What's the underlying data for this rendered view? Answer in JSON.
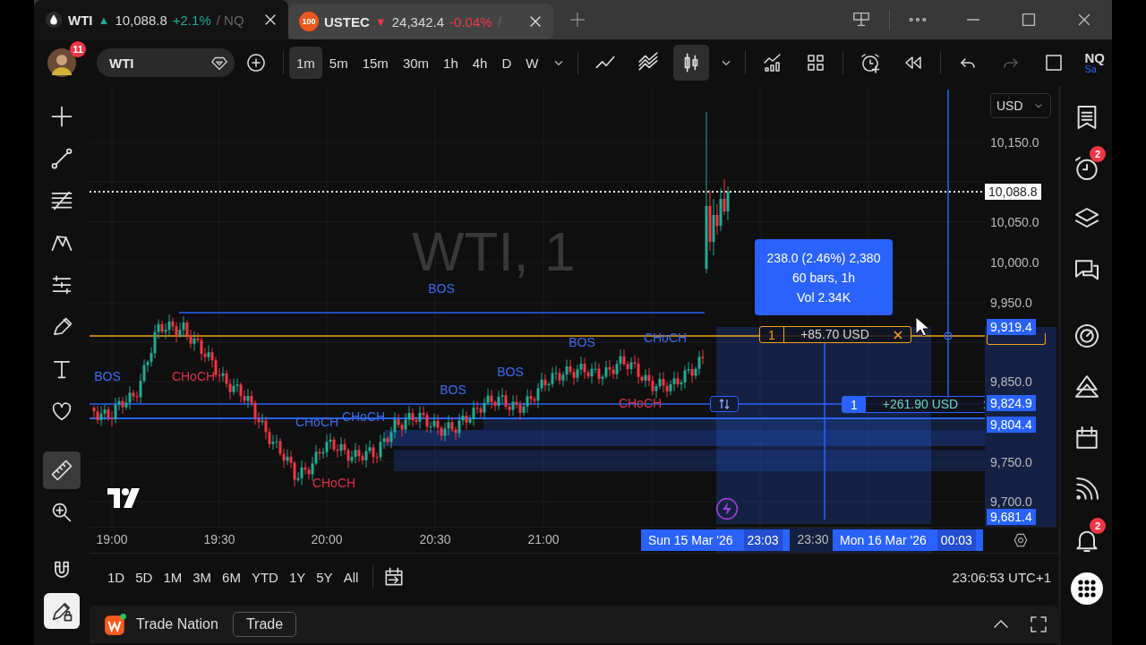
{
  "tabs": [
    {
      "logo": {
        "kind": "drop"
      },
      "label": "WTI",
      "arrow": "▲",
      "color": "#22ab94",
      "price": "10,088.8",
      "change": "+2.1%",
      "extra": "/ NQ",
      "selected": true
    },
    {
      "logo": {
        "kind": "badge",
        "text": "100"
      },
      "label": "USTEC",
      "arrow": "▼",
      "color": "#f23645",
      "price": "24,342.4",
      "change": "-0.04%",
      "extra": "/",
      "selected": false
    }
  ],
  "user": {
    "notifications": "11"
  },
  "symbol_search": {
    "value": "WTI"
  },
  "intervals": [
    {
      "label": "1m",
      "selected": true
    },
    {
      "label": "5m",
      "selected": false
    },
    {
      "label": "15m",
      "selected": false
    },
    {
      "label": "30m",
      "selected": false
    },
    {
      "label": "1h",
      "selected": false
    },
    {
      "label": "4h",
      "selected": false
    },
    {
      "label": "D",
      "selected": false
    },
    {
      "label": "W",
      "selected": false
    }
  ],
  "chart_types": [
    {
      "kind": "line",
      "selected": false
    },
    {
      "kind": "lines",
      "selected": false
    },
    {
      "kind": "candles",
      "selected": true
    }
  ],
  "redo": {
    "disabled": true
  },
  "layout": {
    "label": "NQ",
    "sub": "Sa"
  },
  "tool_groups": [
    {
      "tools": [
        {
          "kind": "crosshair",
          "selected": false
        },
        {
          "kind": "trendline",
          "selected": false
        },
        {
          "kind": "fib",
          "selected": false
        },
        {
          "kind": "pattern",
          "selected": false
        },
        {
          "kind": "projection",
          "selected": false
        },
        {
          "kind": "brush",
          "selected": false
        },
        {
          "kind": "text",
          "selected": false
        },
        {
          "kind": "heart",
          "selected": false
        }
      ]
    },
    {
      "tools": [
        {
          "kind": "ruler",
          "selected": true
        },
        {
          "kind": "zoom",
          "selected": false
        }
      ]
    },
    {
      "tools": [
        {
          "kind": "magnet",
          "selected": false
        }
      ]
    }
  ],
  "drawing_lock": {
    "on": true
  },
  "chart": {
    "watermark": "WTI, 1",
    "annotations": [
      {
        "text": "BOS",
        "color": "#3b6cf0"
      },
      {
        "text": "BOS",
        "color": "#3b6cf0"
      },
      {
        "text": "CHoCH",
        "color": "#e0324a"
      },
      {
        "text": "CHoCH",
        "color": "#3b6cf0"
      },
      {
        "text": "BOS",
        "color": "#3b6cf0"
      },
      {
        "text": "BOS",
        "color": "#3b6cf0"
      },
      {
        "text": "BOS",
        "color": "#3b6cf0"
      },
      {
        "text": "CHoCH",
        "color": "#3b6cf0"
      },
      {
        "text": "CHoCH",
        "color": "#3b6cf0"
      },
      {
        "text": "CHoCH",
        "color": "#e0324a"
      },
      {
        "text": "CHoCH",
        "color": "#e0324a"
      }
    ],
    "measure": {
      "lines": [
        "238.0 (2.46%) 2,380",
        "60 bars, 1h",
        "Vol 2.34K"
      ]
    },
    "orders": [
      {
        "kind": "order",
        "qty": "1",
        "pnl": "+85.70 USD"
      },
      {
        "kind": "position",
        "qty": "1",
        "pnl": "+261.90 USD"
      }
    ]
  },
  "price_axis": {
    "currency": "USD",
    "labels": [
      {
        "kind": "tick",
        "text": "10,150.0"
      },
      {
        "kind": "last",
        "text": "10,088.8"
      },
      {
        "kind": "tick",
        "text": "10,050.0"
      },
      {
        "kind": "tick",
        "text": "10,000.0"
      },
      {
        "kind": "tick",
        "text": "9,950.0"
      },
      {
        "kind": "marker",
        "text": "9,919.4"
      },
      {
        "kind": "tick",
        "text": "9,850.0"
      },
      {
        "kind": "marker",
        "text": "9,824.9"
      },
      {
        "kind": "marker",
        "text": "9,804.4"
      },
      {
        "kind": "tick",
        "text": "9,750.0"
      },
      {
        "kind": "tick",
        "text": "9,700.0"
      },
      {
        "kind": "marker",
        "text": "9,681.4"
      }
    ]
  },
  "time_axis": [
    {
      "kind": "tick",
      "text": "19:00"
    },
    {
      "kind": "tick",
      "text": "19:30"
    },
    {
      "kind": "tick",
      "text": "20:00"
    },
    {
      "kind": "tick",
      "text": "20:30"
    },
    {
      "kind": "tick",
      "text": "21:00"
    },
    {
      "kind": "marker",
      "date": "Sun 15 Mar '26",
      "time": "23:03"
    },
    {
      "kind": "tick",
      "text": "23:30"
    },
    {
      "kind": "marker",
      "date": "Mon 16 Mar '26",
      "time": "00:03"
    }
  ],
  "ranges": [
    "1D",
    "5D",
    "1M",
    "3M",
    "6M",
    "YTD",
    "1Y",
    "5Y",
    "All"
  ],
  "clock": "23:06:53 UTC+1",
  "broker": {
    "name": "Trade Nation",
    "button": "Trade"
  },
  "sidebar": [
    {
      "kind": "watchlist"
    },
    {
      "kind": "alerts",
      "badge": "2"
    },
    {
      "kind": "layers"
    },
    {
      "kind": "chat"
    },
    {
      "kind": "radar"
    },
    {
      "kind": "ideas"
    },
    {
      "kind": "calendar"
    },
    {
      "kind": "broadcast"
    },
    {
      "kind": "bell",
      "badge": "2"
    },
    {
      "kind": "apps"
    }
  ]
}
